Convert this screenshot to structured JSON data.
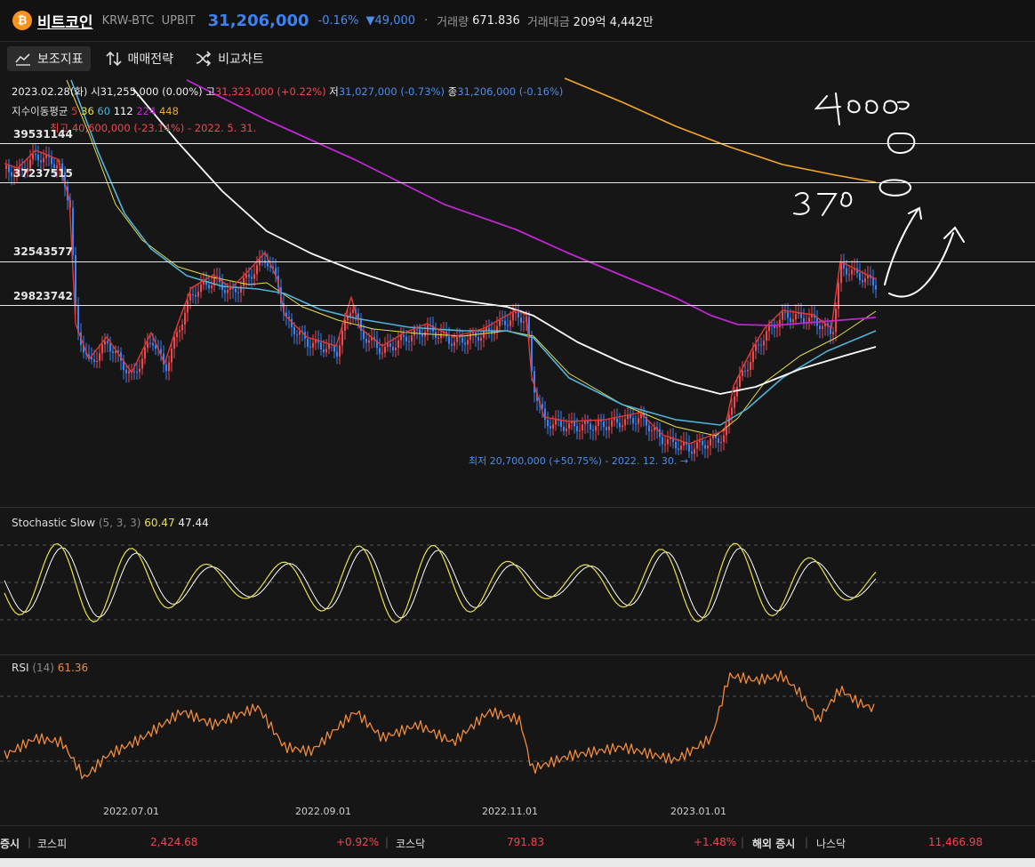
{
  "header": {
    "coin_name": "비트코인",
    "pair": "KRW-BTC",
    "exchange": "UPBIT",
    "price": "31,206,000",
    "change_pct": "-0.16%",
    "change_abs": "▼49,000",
    "volume_label": "거래량",
    "volume_value": "671.836",
    "trade_amount_label": "거래대금",
    "trade_amount_value": "209억 4,442만"
  },
  "toolbar": {
    "indicators": "보조지표",
    "strategy": "매매전략",
    "compare": "비교차트"
  },
  "ohlc": {
    "date": "2023.02.28(화)",
    "open_label": "시",
    "open": "31,255,000 (0.00%)",
    "high_label": "고",
    "high": "31,323,000 (+0.22%)",
    "low_label": "저",
    "low": "31,027,000 (-0.73%)",
    "close_label": "종",
    "close": "31,206,000 (-0.16%)"
  },
  "ma": {
    "label": "지수이동평균",
    "periods": [
      "5",
      "36",
      "60",
      "112",
      "224",
      "448"
    ],
    "colors": [
      "#e53935",
      "#e8e04a",
      "#4fb3d9",
      "#ffffff",
      "#c026d3",
      "#f5a623"
    ]
  },
  "annotations": {
    "max": "최고 40,600,000 (-23.14%) - 2022. 5. 31.",
    "min": "최저 20,700,000 (+50.75%) - 2022. 12. 30. →"
  },
  "levels": [
    "39531144",
    "37237515",
    "32543577",
    "29823742"
  ],
  "handwriting": [
    "4000",
    "3700"
  ],
  "stochastic": {
    "label": "Stochastic Slow",
    "params": "(5, 3, 3)",
    "k": "60.47",
    "d": "47.44"
  },
  "rsi": {
    "label": "RSI",
    "params": "(14)",
    "value": "61.36"
  },
  "x_axis": [
    "2022.07.01",
    "2022.09.01",
    "2022.11.01",
    "2023.01.01"
  ],
  "footer": {
    "domestic_label": "증시",
    "kospi_label": "코스피",
    "kospi_value": "2,424.68",
    "kospi_change": "+0.92%",
    "kosdaq_label": "코스닥",
    "kosdaq_value": "791.83",
    "kosdaq_change": "+1.48%",
    "foreign_label": "해외 증시",
    "nasdaq_label": "나스닥",
    "nasdaq_value": "11,466.98"
  },
  "colors": {
    "up": "#f0474f",
    "down": "#3b82f6",
    "background": "#161616"
  }
}
